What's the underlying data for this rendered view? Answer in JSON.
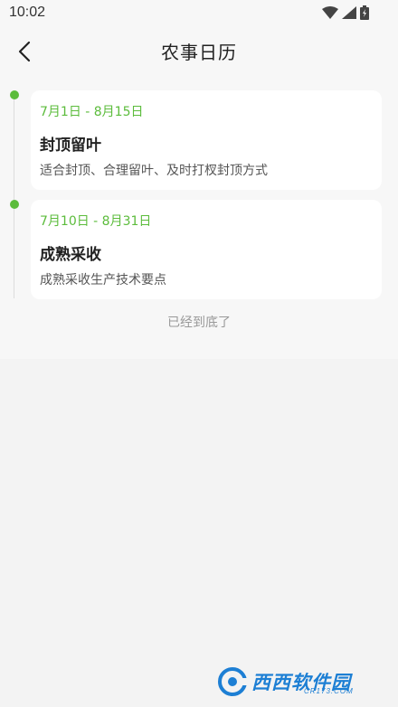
{
  "status_bar": {
    "time": "10:02",
    "icons": [
      "wifi-icon",
      "signal-icon",
      "battery-icon"
    ]
  },
  "header": {
    "title": "农事日历",
    "back_icon": "chevron-left-icon"
  },
  "timeline": {
    "items": [
      {
        "date": "7月1日 - 8月15日",
        "title": "封顶留叶",
        "desc": "适合封顶、合理留叶、及时打杈封顶方式"
      },
      {
        "date": "7月10日 - 8月31日",
        "title": "成熟采收",
        "desc": "成熟采收生产技术要点"
      }
    ],
    "end_note": "已经到底了"
  },
  "watermark": {
    "text": "西西软件园",
    "sub": "CR173.COM"
  },
  "colors": {
    "accent": "#5cbc3c",
    "background": "#f3f3f3",
    "card": "#ffffff"
  }
}
